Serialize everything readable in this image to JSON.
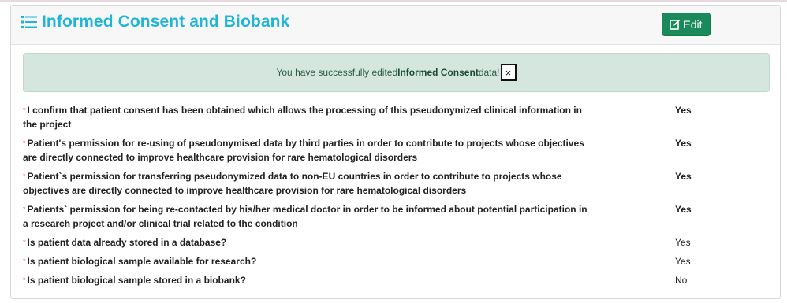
{
  "header": {
    "title": "Informed Consent and Biobank",
    "edit_label": "Edit"
  },
  "alert": {
    "prefix": "You have successfully edited ",
    "emphasis": "Informed Consent",
    "suffix": " data!",
    "close_label": "×"
  },
  "questions": [
    {
      "text": "I confirm that patient consent has been obtained which allows the processing of this pseudonymized clinical information in the project",
      "answer": "Yes",
      "bold": true
    },
    {
      "text": "Patient's permission for re-using of pseudonymised data by third parties in order to contribute to projects whose objectives are directly connected to improve healthcare provision for rare hematological disorders",
      "answer": "Yes",
      "bold": true
    },
    {
      "text": "Patient`s permission for transferring pseudonymized data to non-EU countries in order to contribute to projects whose objectives are directly connected to improve healthcare provision for rare hematological disorders",
      "answer": "Yes",
      "bold": true
    },
    {
      "text": "Patients` permission for being re-contacted by his/her medical doctor in order to be informed about potential participation in a research project and/or clinical trial related to the condition",
      "answer": "Yes",
      "bold": true
    },
    {
      "text": "Is patient data already stored in a database?",
      "answer": "Yes",
      "bold": false
    },
    {
      "text": "Is patient biological sample available for research?",
      "answer": "Yes",
      "bold": false
    },
    {
      "text": "Is patient biological sample stored in a biobank?",
      "answer": "No",
      "bold": false
    }
  ],
  "colors": {
    "title": "#1fb5d8",
    "edit_button": "#1a8a5a",
    "alert_bg": "#d4e6de",
    "required_star": "#e0463a"
  },
  "icons": {
    "title": "list-icon",
    "edit": "edit-icon",
    "close": "close-icon",
    "required": "required-star"
  }
}
